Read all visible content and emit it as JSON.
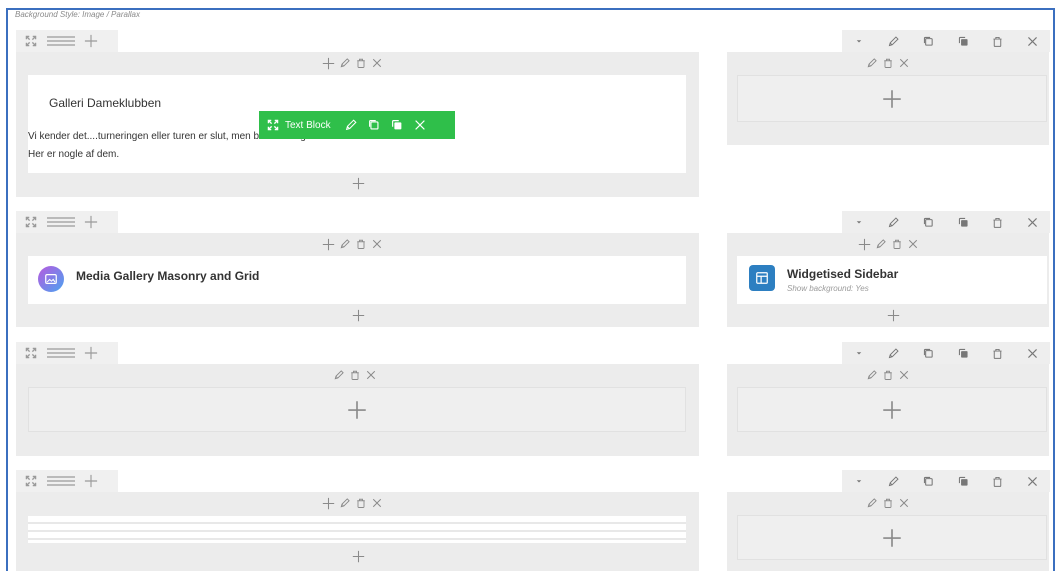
{
  "background_style": "Background Style: Image / Parallax",
  "text_block": {
    "heading": "Galleri Dameklubben",
    "line1": "Vi kender det....turneringen eller turen er slut, men blev der taget billeder?",
    "line2": "Her er nogle af dem."
  },
  "toolbar": {
    "label": "Text Block",
    "color": "#2fbf4a"
  },
  "widgets": {
    "media_gallery": {
      "title": "Media Gallery Masonry and Grid"
    },
    "widgetised_sidebar": {
      "title": "Widgetised Sidebar",
      "subtitle": "Show background: Yes"
    }
  },
  "icons": {
    "row": [
      "move-icon",
      "columns-icon",
      "add-icon"
    ],
    "column": [
      "dropdown-icon",
      "edit-icon",
      "clone-icon",
      "copy-icon",
      "delete-icon",
      "close-icon"
    ],
    "element": [
      "add-icon",
      "edit-icon",
      "delete-icon",
      "close-icon"
    ]
  },
  "colors": {
    "frame_border": "#3b6fbf",
    "gallery_icon_gradient": [
      "#b85adf",
      "#4aa3f0"
    ],
    "sidebar_icon": "#2d7fc1"
  }
}
